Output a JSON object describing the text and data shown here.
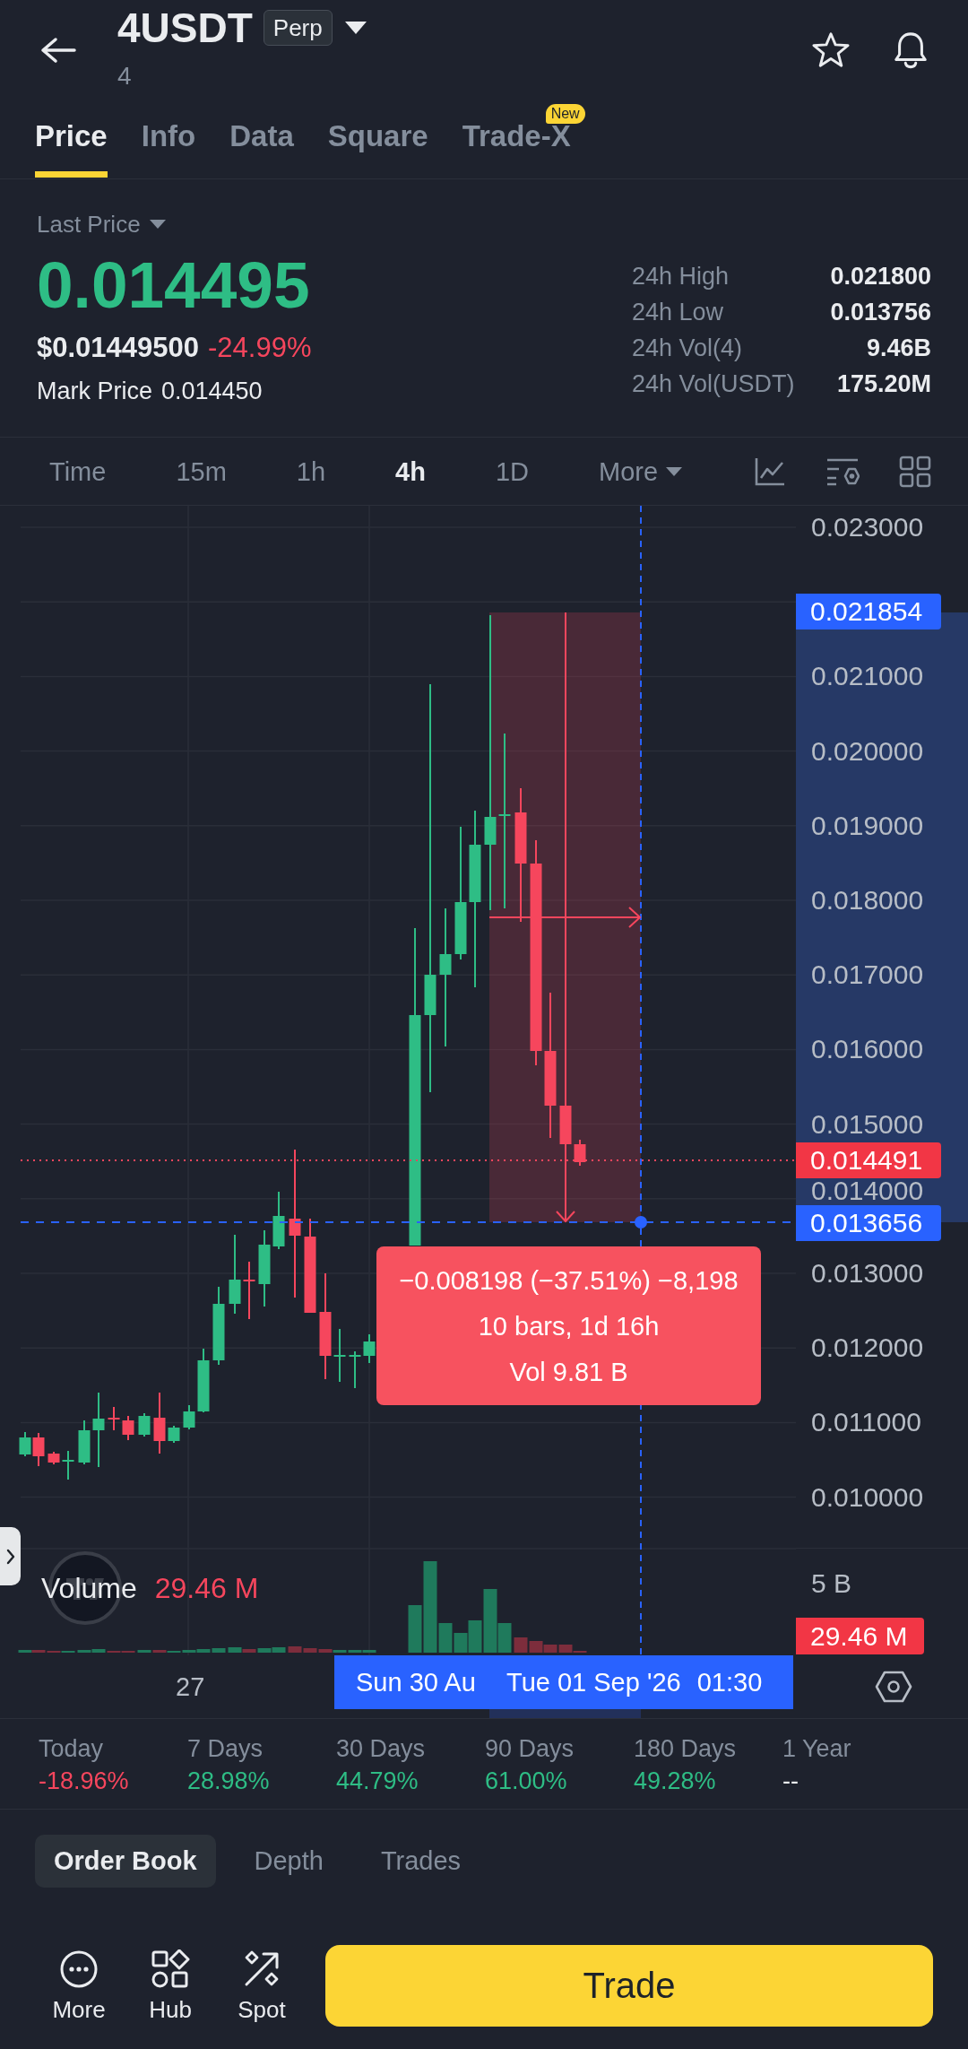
{
  "header": {
    "title": "4USDT",
    "badge": "Perp",
    "subtitle": "4"
  },
  "tabs": [
    {
      "label": "Price",
      "selected": true
    },
    {
      "label": "Info",
      "selected": false
    },
    {
      "label": "Data",
      "selected": false
    },
    {
      "label": "Square",
      "selected": false
    },
    {
      "label": "Trade-X",
      "selected": false,
      "badge": "New"
    }
  ],
  "price_panel": {
    "price_type": "Last Price",
    "last_price": "0.014495",
    "usd_price": "$0.01449500",
    "change": {
      "text": "-24.99%",
      "color": "#f6465d"
    },
    "mark_price_label": "Mark Price",
    "mark_price": "0.014450",
    "stats": [
      {
        "label": "24h High",
        "value": "0.021800"
      },
      {
        "label": "24h Low",
        "value": "0.013756"
      },
      {
        "label": "24h Vol(4)",
        "value": "9.46B"
      },
      {
        "label": "24h Vol(USDT)",
        "value": "175.20M"
      }
    ]
  },
  "intervals": [
    {
      "label": "Time",
      "kind": "option",
      "selected": false
    },
    {
      "label": "15m",
      "kind": "option",
      "selected": false
    },
    {
      "label": "1h",
      "kind": "option",
      "selected": false
    },
    {
      "label": "4h",
      "kind": "option",
      "selected": true
    },
    {
      "label": "1D",
      "kind": "option",
      "selected": false
    },
    {
      "label": "More",
      "kind": "dropdown",
      "selected": false
    }
  ],
  "chart": {
    "price_axis": [
      "0.023000",
      "0.021000",
      "0.020000",
      "0.019000",
      "0.018000",
      "0.017000",
      "0.016000",
      "0.015000",
      "0.014000",
      "0.013000",
      "0.012000",
      "0.011000",
      "0.010000"
    ],
    "price_tags": [
      {
        "text": "0.021854",
        "kind": "range"
      },
      {
        "text": "0.014491",
        "kind": "last"
      },
      {
        "text": "0.013656",
        "kind": "range"
      }
    ],
    "measure_tooltip": [
      "−0.008198 (−37.51%) −8,198",
      "10 bars, 1d 16h",
      "Vol 9.81 B"
    ],
    "volume": {
      "label": "Volume",
      "value": "29.46 M",
      "axis_label": "5 B",
      "tag": "29.46 M"
    },
    "time_axis": {
      "labels": [
        "27"
      ],
      "start_label": "Sun 30 Au",
      "end_date": "Tue 01 Sep '26",
      "end_time": "01:30"
    }
  },
  "performance": [
    {
      "label": "Today",
      "value": "-18.96%",
      "color": "#f6465d"
    },
    {
      "label": "7 Days",
      "value": "28.98%",
      "color": "#2ebd85"
    },
    {
      "label": "30 Days",
      "value": "44.79%",
      "color": "#2ebd85"
    },
    {
      "label": "90 Days",
      "value": "61.00%",
      "color": "#2ebd85"
    },
    {
      "label": "180 Days",
      "value": "49.28%",
      "color": "#2ebd85"
    },
    {
      "label": "1 Year",
      "value": "--",
      "color": "#eaecef"
    }
  ],
  "book_tabs": [
    {
      "label": "Order Book",
      "selected": true
    },
    {
      "label": "Depth",
      "selected": false
    },
    {
      "label": "Trades",
      "selected": false
    }
  ],
  "bottom_nav": [
    {
      "label": "More",
      "kind": "more"
    },
    {
      "label": "Hub",
      "kind": "hub"
    },
    {
      "label": "Spot",
      "kind": "spot"
    }
  ],
  "trade_button": "Trade"
}
